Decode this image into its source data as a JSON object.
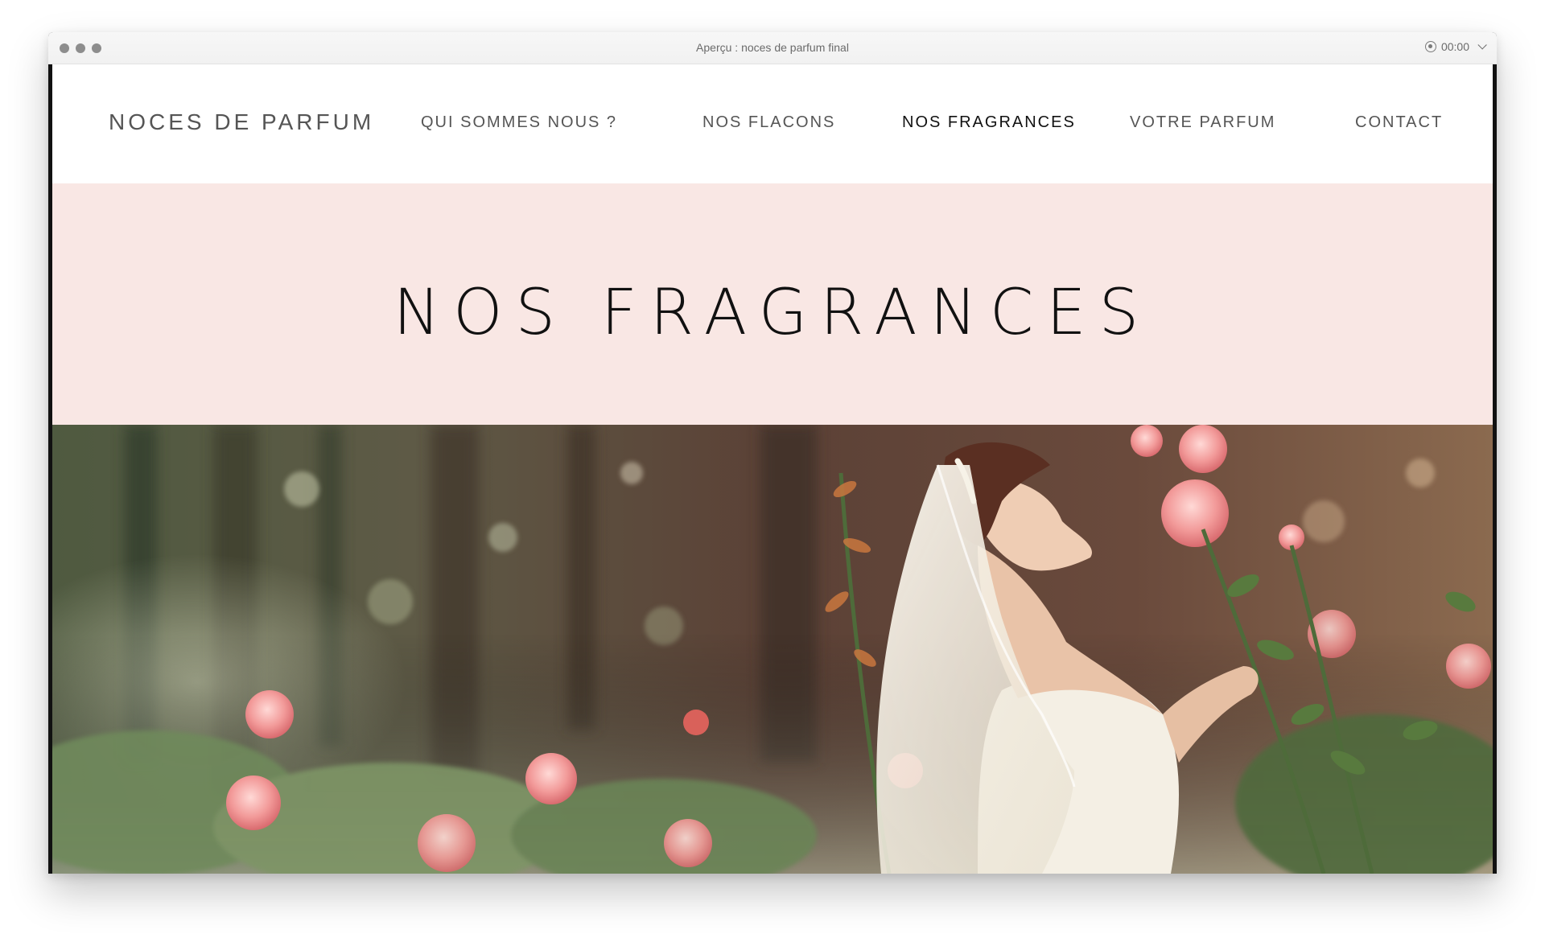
{
  "window": {
    "title": "Aperçu : noces de parfum final",
    "recording_time": "00:00"
  },
  "site": {
    "brand": "NOCES DE PARFUM",
    "nav": [
      {
        "label": "QUI SOMMES NOUS ?"
      },
      {
        "label": "NOS FLACONS"
      },
      {
        "label": "NOS FRAGRANCES",
        "active": true
      },
      {
        "label": "VOTRE PARFUM"
      },
      {
        "label": "CONTACT"
      }
    ],
    "hero_title": "NOS FRAGRANCES"
  },
  "colors": {
    "hero_band": "#f9e7e4",
    "nav_text": "#555555",
    "nav_active": "#111111"
  },
  "icons": {
    "window_controls": [
      "close-dot",
      "minimize-dot",
      "zoom-dot"
    ],
    "recording": "record-icon",
    "menu": "chevron-down-icon"
  }
}
